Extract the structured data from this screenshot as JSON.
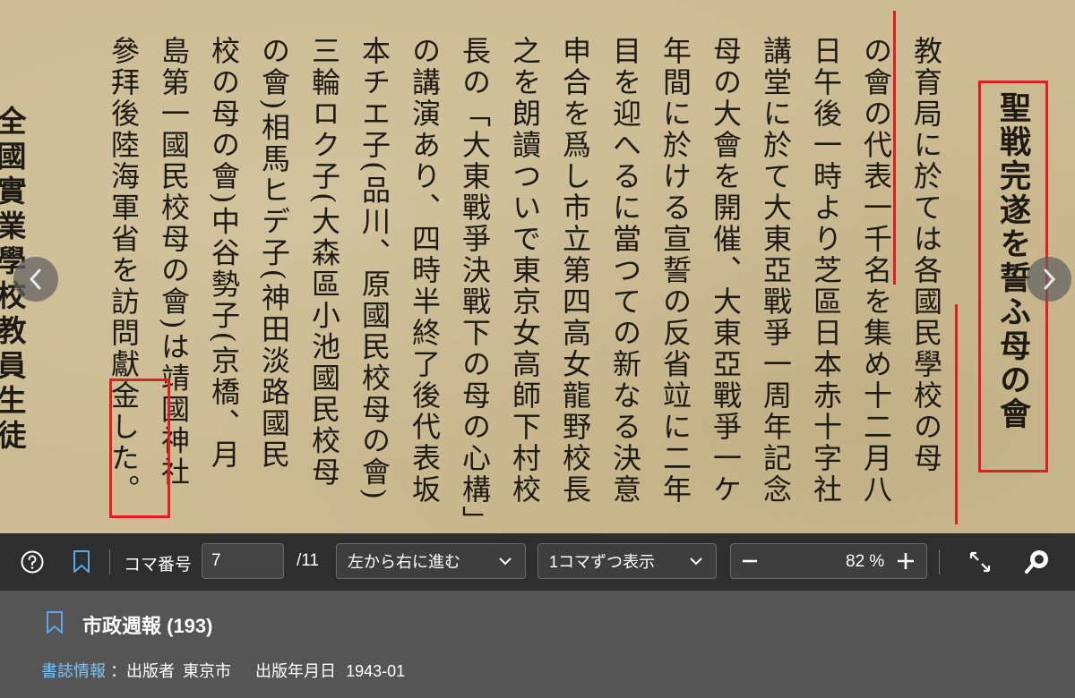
{
  "scan": {
    "headline": "聖戦完遂を誓ふ母の會",
    "side_heading": "全國實業學校教員生徒",
    "columns": [
      "教育局に於ては各國民學校の母",
      "の會の代表一千名を集め十二月八",
      "日午後一時より芝區日本赤十字社",
      "講堂に於て大東亞戰爭一周年記念",
      "母の大會を開催、大東亞戰爭一ケ",
      "年間に於ける宣誓の反省竝に二年",
      "目を迎へるに當つての新なる決意",
      "申合を爲し市立第四高女龍野校長",
      "之を朗讀ついで東京女高師下村校",
      "長の「大東戰爭決戰下の母の心構」",
      "の講演あり、四時半終了後代表坂",
      "本チエ子(品川、原國民校母の會)",
      "三輪ロク子(大森區小池國民校母",
      "の會)相馬ヒデ子(神田淡路國民",
      "校の母の會)中谷勢子(京橋、月",
      "島第一國民校母の會)は靖國神社",
      "參拜後陸海軍省を訪問獻金した。"
    ],
    "annotation_color": "#e31b23",
    "prev_icon": "chevron-left-icon",
    "next_icon": "chevron-right-icon"
  },
  "toolbar": {
    "help_icon": "help-circle-icon",
    "bookmark_icon": "bookmark-icon",
    "frame_label": "コマ番号",
    "frame_value": "7",
    "frame_total": "/11",
    "direction_select": "左から右に進む",
    "display_select": "1コマずつ表示",
    "zoom_value": "82",
    "zoom_unit": "%",
    "fullscreen_icon": "fullscreen-icon",
    "search_icon": "search-icon"
  },
  "info": {
    "title": "市政週報 (193)",
    "biblio_link": "書誌情報",
    "publisher_label": "：出版者",
    "publisher": "東京市",
    "date_label": "出版年月日",
    "date": "1943-01"
  },
  "colors": {
    "toolbar_bg": "#2e2e2e",
    "panel_bg": "#555555",
    "link": "#7cc4f5",
    "bookmark_icon": "#5aa9e6"
  }
}
